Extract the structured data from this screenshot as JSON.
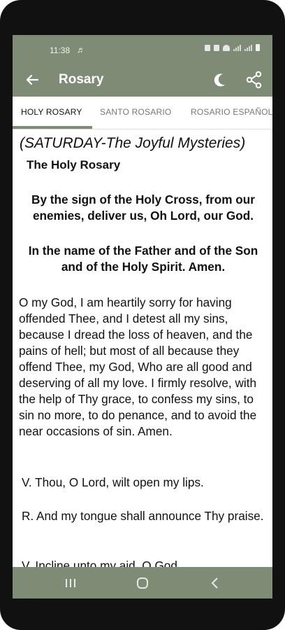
{
  "status": {
    "time": "11:38",
    "music_icon": "music-note-icon"
  },
  "appbar": {
    "title": "Rosary",
    "back_icon": "back-arrow-icon",
    "theme_icon": "moon-icon",
    "share_icon": "share-icon"
  },
  "tabs": [
    {
      "label": "HOLY ROSARY",
      "active": true
    },
    {
      "label": "SANTO ROSARIO",
      "active": false
    },
    {
      "label": "ROSARIO ESPAÑOL",
      "active": false
    }
  ],
  "content": {
    "heading": "(SATURDAY-The Joyful Mysteries)",
    "subheading": "The Holy Rosary",
    "sign_of_cross": "By the sign of the Holy Cross, from our enemies, deliver us, Oh Lord, our God.",
    "in_the_name": "In the name of the Father and of the Son and of the Holy Spirit. Amen.",
    "act_of_contrition": "O my God, I am heartily sorry for having offended Thee, and I detest all my sins, because I dread the loss of heaven, and the pains of hell; but most of all because they offend Thee, my God, Who are all good and deserving of all my love. I firmly resolve, with the help of Thy grace, to confess my sins, to sin no more, to do penance, and to avoid the near occasions of sin. Amen.",
    "versicle_1": "V. Thou, O Lord, wilt open my lips.",
    "response_1": "R. And my tongue shall announce Thy praise.",
    "versicle_2": "V. Incline unto my aid, O God."
  },
  "navbar": {
    "recents_icon": "recents-icon",
    "home_icon": "home-icon",
    "back_icon": "back-icon"
  },
  "colors": {
    "accent": "#7f8c75",
    "text": "#111111",
    "tab_inactive": "#777777"
  }
}
